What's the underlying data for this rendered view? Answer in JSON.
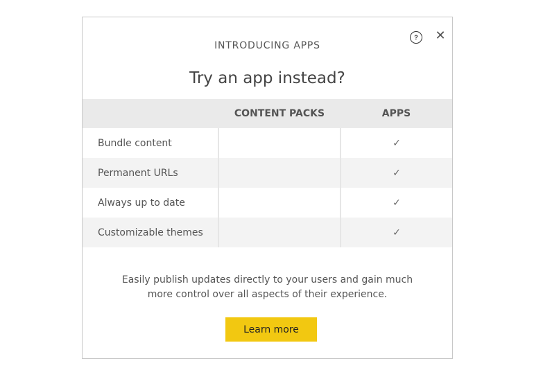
{
  "dialog": {
    "eyebrow": "INTRODUCING APPS",
    "title": "Try an app instead?",
    "help_icon": "question-circle-icon",
    "help_glyph": "?",
    "close_icon": "close-x-icon",
    "close_glyph": "✕"
  },
  "table": {
    "headers": [
      "",
      "CONTENT PACKS",
      "APPS"
    ],
    "rows": [
      {
        "feature": "Bundle content",
        "content_packs": "",
        "apps": "✓"
      },
      {
        "feature": "Permanent URLs",
        "content_packs": "",
        "apps": "✓"
      },
      {
        "feature": "Always up to date",
        "content_packs": "",
        "apps": "✓"
      },
      {
        "feature": "Customizable themes",
        "content_packs": "",
        "apps": "✓"
      }
    ]
  },
  "description": "Easily publish updates directly to your users and gain much more control over all aspects of their experience.",
  "cta": {
    "label": "Learn more",
    "color": "#f2c811"
  }
}
